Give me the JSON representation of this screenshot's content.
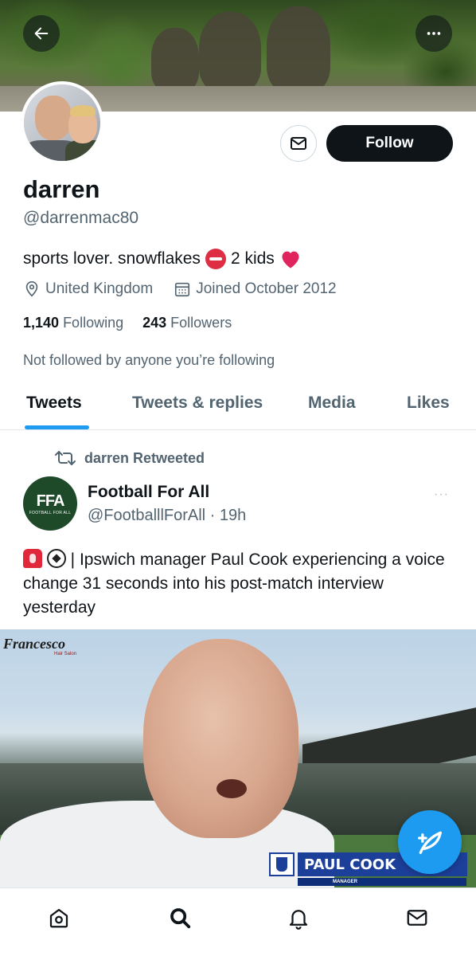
{
  "profile": {
    "name": "darren",
    "handle": "@darrenmac80",
    "bio_part1": "sports lover. snowflakes",
    "bio_part2": "2 kids",
    "location": "United Kingdom",
    "joined": "Joined October 2012",
    "following_count": "1,140",
    "following_label": "Following",
    "followers_count": "243",
    "followers_label": "Followers",
    "not_followed_text": "Not followed by anyone you’re following"
  },
  "actions": {
    "follow_label": "Follow"
  },
  "tabs": [
    {
      "label": "Tweets",
      "active": true
    },
    {
      "label": "Tweets & replies",
      "active": false
    },
    {
      "label": "Media",
      "active": false
    },
    {
      "label": "Likes",
      "active": false
    }
  ],
  "tweet": {
    "retweet_label": "darren Retweeted",
    "author_name": "Football For All",
    "author_handle": "@FootballlForAll · 19h",
    "avatar_text": "FFA",
    "avatar_subtext": "FOOTBALL FOR ALL",
    "text": " | Ipswich manager Paul Cook experiencing a voice change 31 seconds into his post-match interview yesterday",
    "more": "···",
    "media": {
      "brand": "Francesco",
      "brand_sub": "Hair Salon",
      "caption_name": "PAUL COOK",
      "caption_role": "MANAGER"
    }
  },
  "icons": {
    "back": "arrow-left-icon",
    "more": "more-horizontal-icon",
    "message": "envelope-icon",
    "location": "location-pin-icon",
    "calendar": "calendar-icon",
    "retweet": "retweet-icon",
    "compose": "compose-feather-icon",
    "home": "home-icon",
    "search": "search-icon",
    "notifications": "bell-icon",
    "messages": "mail-icon"
  },
  "colors": {
    "accent": "#1d9bf0",
    "text": "#0f1419",
    "muted": "#536471",
    "heart": "#e0245e"
  }
}
